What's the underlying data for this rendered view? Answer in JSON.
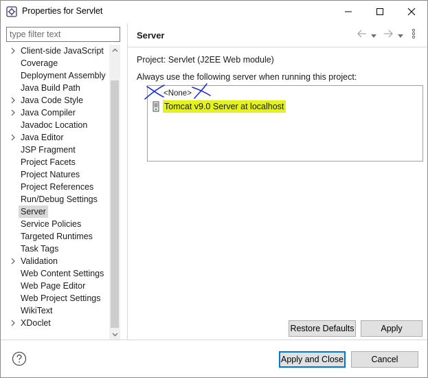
{
  "window": {
    "title": "Properties for Servlet"
  },
  "filter": {
    "placeholder": "type filter text",
    "value": ""
  },
  "tree": {
    "items": [
      {
        "label": "Client-side JavaScript",
        "expandable": true
      },
      {
        "label": "Coverage",
        "expandable": false
      },
      {
        "label": "Deployment Assembly",
        "expandable": false
      },
      {
        "label": "Java Build Path",
        "expandable": false
      },
      {
        "label": "Java Code Style",
        "expandable": true
      },
      {
        "label": "Java Compiler",
        "expandable": true
      },
      {
        "label": "Javadoc Location",
        "expandable": false
      },
      {
        "label": "Java Editor",
        "expandable": true
      },
      {
        "label": "JSP Fragment",
        "expandable": false
      },
      {
        "label": "Project Facets",
        "expandable": false
      },
      {
        "label": "Project Natures",
        "expandable": false
      },
      {
        "label": "Project References",
        "expandable": false
      },
      {
        "label": "Run/Debug Settings",
        "expandable": false
      },
      {
        "label": "Server",
        "expandable": false,
        "selected": true
      },
      {
        "label": "Service Policies",
        "expandable": false
      },
      {
        "label": "Targeted Runtimes",
        "expandable": false
      },
      {
        "label": "Task Tags",
        "expandable": false
      },
      {
        "label": "Validation",
        "expandable": true
      },
      {
        "label": "Web Content Settings",
        "expandable": false
      },
      {
        "label": "Web Page Editor",
        "expandable": false
      },
      {
        "label": "Web Project Settings",
        "expandable": false
      },
      {
        "label": "WikiText",
        "expandable": false
      },
      {
        "label": "XDoclet",
        "expandable": true
      }
    ]
  },
  "page": {
    "title": "Server",
    "project_line": "Project: Servlet (J2EE Web module)",
    "instruction": "Always use the following server when running this project:",
    "servers": [
      {
        "label": "<None>",
        "icon": "none"
      },
      {
        "label": "Tomcat v9.0 Server at localhost",
        "icon": "server-icon",
        "highlight": "#e5f219"
      }
    ]
  },
  "buttons": {
    "restore_defaults": "Restore Defaults",
    "apply": "Apply",
    "apply_and_close": "Apply and Close",
    "cancel": "Cancel"
  },
  "colors": {
    "highlight": "#e5f219",
    "annotation_ink": "#1a2fd6",
    "default_button_border": "#0078d7"
  },
  "icons": {
    "app": "eclipse-properties-icon",
    "help": "help-icon",
    "back": "back-arrow-icon",
    "forward": "forward-arrow-icon",
    "menu": "view-menu-icon"
  }
}
